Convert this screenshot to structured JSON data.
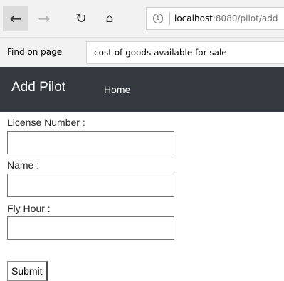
{
  "browser": {
    "back_icon": "←",
    "forward_icon": "→",
    "refresh_icon": "↻",
    "home_icon": "⌂",
    "info_icon": "i",
    "url_host": "localhost",
    "url_rest": ":8080/pilot/add"
  },
  "find_bar": {
    "label": "Find on page",
    "value": "cost of goods available for sale"
  },
  "navbar": {
    "brand": "Add Pilot",
    "home_link": "Home",
    "background": "#343a40"
  },
  "form": {
    "license_label": "License Number :",
    "license_value": "",
    "name_label": "Name :",
    "name_value": "",
    "fly_hour_label": "Fly Hour :",
    "fly_hour_value": "",
    "submit_label": "Submit"
  }
}
